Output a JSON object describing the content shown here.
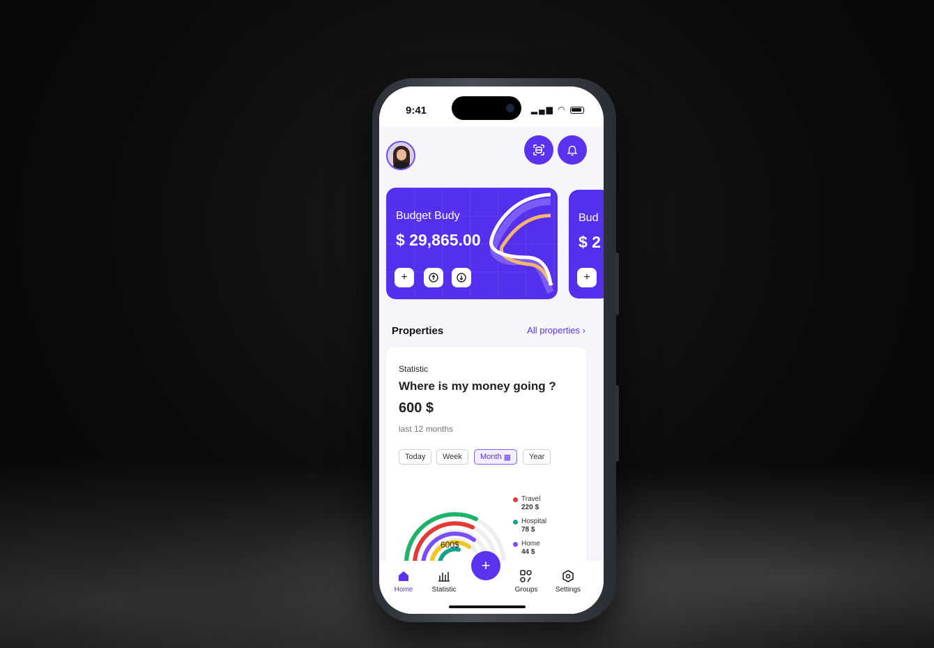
{
  "status_bar": {
    "time": "9:41"
  },
  "header": {
    "avatar": "avatar",
    "scan_icon": "scan-icon",
    "bell_icon": "bell-icon"
  },
  "cards": [
    {
      "title": "Budget Budy",
      "amount": "$ 29,865.00"
    },
    {
      "title": "Bud",
      "amount": "$ 2"
    }
  ],
  "card_buttons": {
    "add": "+"
  },
  "properties": {
    "title": "Properties",
    "link": "All properties"
  },
  "statistic": {
    "label": "Statistic",
    "question": "Where is my money going ?",
    "amount": "600 $",
    "period": "last 12 months",
    "filters": [
      "Today",
      "Week",
      "Month",
      "Year"
    ],
    "active_filter": "Month",
    "center_label": "600$",
    "legend": [
      {
        "name": "Travel",
        "value": "220 $",
        "color": "#e53935"
      },
      {
        "name": "Hospital",
        "value": "78 $",
        "color": "#12a38a"
      },
      {
        "name": "Home",
        "value": "44 $",
        "color": "#7a4dfa"
      }
    ]
  },
  "nav": {
    "items": [
      "Home",
      "Statistic",
      "Groups",
      "Settings"
    ],
    "fab": "+"
  },
  "colors": {
    "accent": "#5a32f0",
    "card": "#5430ee"
  }
}
